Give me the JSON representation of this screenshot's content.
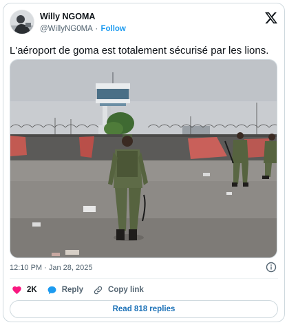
{
  "author": {
    "display_name": "Willy NGOMA",
    "handle": "@WillyNG0MA",
    "separator": "·",
    "follow_label": "Follow"
  },
  "tweet": {
    "text": "L'aéroport de goma est totalement sécurisé par les lions.",
    "timestamp": "12:10 PM · Jan 28, 2025"
  },
  "actions": {
    "like_count": "2K",
    "reply_label": "Reply",
    "copy_link_label": "Copy link"
  },
  "read_replies_label": "Read 818 replies",
  "icons": {
    "logo": "x-logo-icon",
    "like": "heart-icon",
    "reply": "speech-bubble-icon",
    "copy_link": "link-icon",
    "info": "info-icon"
  },
  "colors": {
    "like": "#f91880",
    "reply_bubble": "#1d9bf0",
    "follow": "#1d9bf0",
    "read_replies": "#1d72b8",
    "muted_text": "#536471"
  }
}
